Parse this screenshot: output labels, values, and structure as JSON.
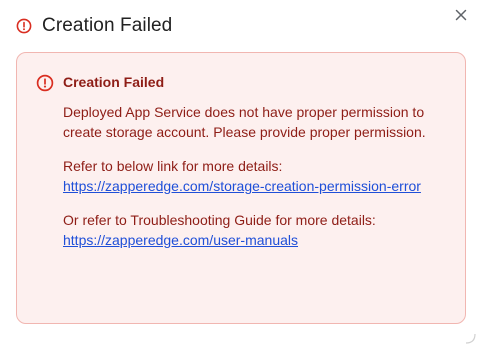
{
  "dialog": {
    "title": "Creation Failed",
    "icons": {
      "header": "error-circle-icon",
      "close": "close-icon",
      "alert": "error-circle-icon"
    },
    "close_label": "×"
  },
  "alert": {
    "title": "Creation Failed",
    "message": "Deployed App Service does not have proper permission to create storage account. Please provide proper permission.",
    "refer_text_1": "Refer to below link for more details:",
    "link_1": "https://zapperedge.com/storage-creation-permission-error",
    "refer_text_2": "Or refer to Troubleshooting Guide for more details:",
    "link_2": "https://zapperedge.com/user-manuals"
  },
  "colors": {
    "alert_bg": "#fdf0ef",
    "alert_border": "#f1b6b1",
    "error_text": "#8e1d16",
    "link": "#1f4fd8",
    "icon_red": "#d92d20"
  }
}
